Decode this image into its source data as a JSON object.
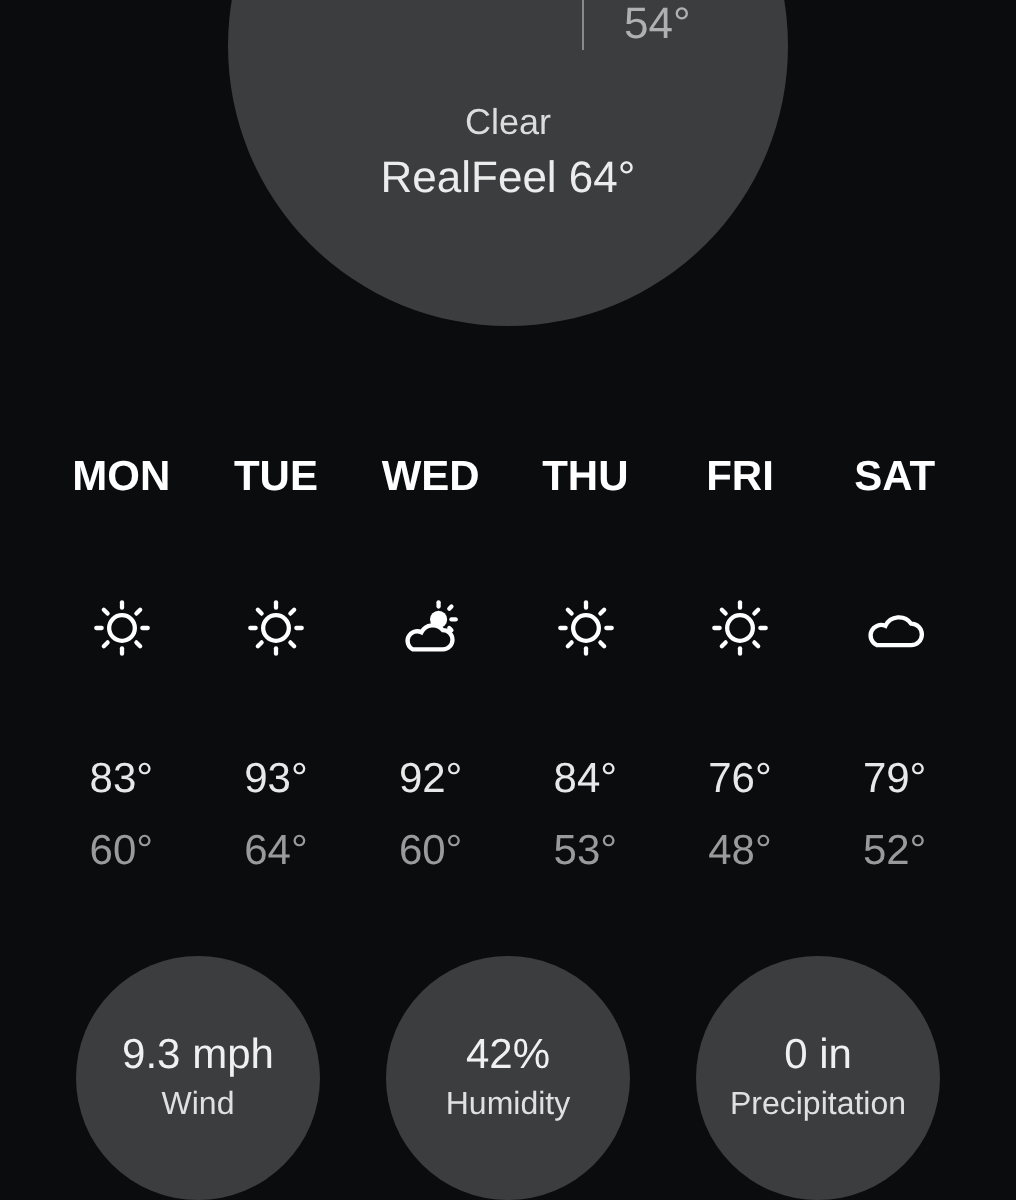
{
  "current": {
    "low": "54°",
    "condition": "Clear",
    "realfeel": "RealFeel 64°"
  },
  "forecast": [
    {
      "day": "MON",
      "kind": "sun",
      "high": "83°",
      "low": "60°"
    },
    {
      "day": "TUE",
      "kind": "sun",
      "high": "93°",
      "low": "64°"
    },
    {
      "day": "WED",
      "kind": "partly-cloudy",
      "high": "92°",
      "low": "60°"
    },
    {
      "day": "THU",
      "kind": "sun",
      "high": "84°",
      "low": "53°"
    },
    {
      "day": "FRI",
      "kind": "sun",
      "high": "76°",
      "low": "48°"
    },
    {
      "day": "SAT",
      "kind": "cloud",
      "high": "79°",
      "low": "52°"
    }
  ],
  "stats": [
    {
      "value": "9.3 mph",
      "label": "Wind"
    },
    {
      "value": "42%",
      "label": "Humidity"
    },
    {
      "value": "0 in",
      "label": "Precipitation"
    }
  ]
}
